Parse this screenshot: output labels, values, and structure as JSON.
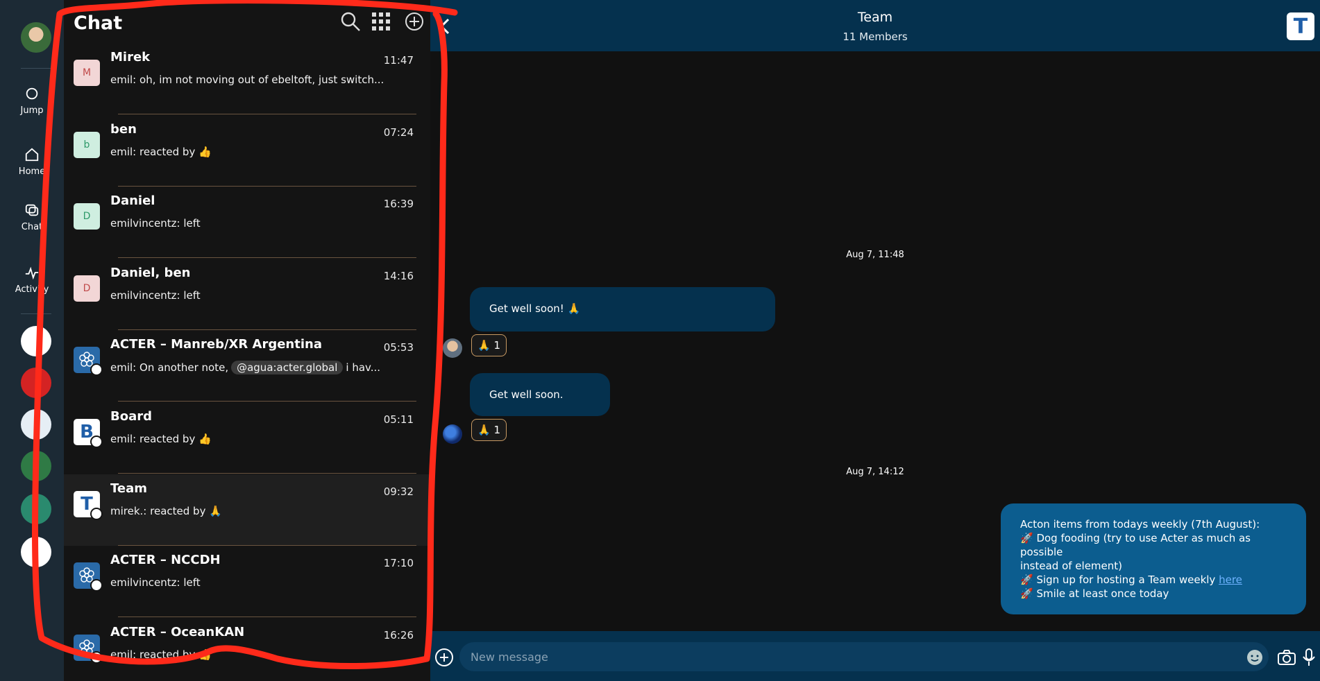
{
  "rail": {
    "items": [
      {
        "label": "Jump"
      },
      {
        "label": "Home"
      },
      {
        "label": "Chat"
      },
      {
        "label": "Activity"
      }
    ],
    "space_colors": [
      "#ffffff",
      "#d42323",
      "#e6eef5",
      "#2f7a45",
      "#2a8a6e",
      "#ffffff"
    ]
  },
  "chatlist": {
    "title": "Chat",
    "rooms": [
      {
        "name": "Mirek",
        "time": "11:47",
        "sender": "emil:",
        "text": "oh, im not moving out of ebeltoft, just switch...",
        "avatar_letter": "M",
        "avatar_bg": "#f2d6d6",
        "avatar_fg": "#c14a4a"
      },
      {
        "name": "ben",
        "time": "07:24",
        "sender": "emil:",
        "text": "reacted by 👍",
        "avatar_letter": "b",
        "avatar_bg": "#cfeee0",
        "avatar_fg": "#2f9a6a"
      },
      {
        "name": "Daniel",
        "time": "16:39",
        "sender": "emilvincentz:",
        "text": "left",
        "avatar_letter": "D",
        "avatar_bg": "#cfeee0",
        "avatar_fg": "#2f9a6a"
      },
      {
        "name": "Daniel, ben",
        "time": "14:16",
        "sender": "emilvincentz:",
        "text": "left",
        "avatar_letter": "D",
        "avatar_bg": "#f2d6d6",
        "avatar_fg": "#c14a4a"
      },
      {
        "name": "ACTER – Manreb/XR Argentina",
        "time": "05:53",
        "sender": "emil:",
        "text_before": "On another note,",
        "mention": "@agua:acter.global",
        "text_after": "i hav...",
        "avatar_letter": "",
        "avatar_bg": "#2a6aa8",
        "avatar_fg": "#ffffff"
      },
      {
        "name": "Board",
        "time": "05:11",
        "sender": "emil:",
        "text": "reacted by 👍",
        "avatar_letter": "B",
        "avatar_bg": "#ffffff",
        "avatar_fg": "#1f5ea8"
      },
      {
        "name": "Team",
        "time": "09:32",
        "sender": "mirek.:",
        "text": "reacted by 🙏",
        "avatar_letter": "T",
        "avatar_bg": "#ffffff",
        "avatar_fg": "#1f5ea8"
      },
      {
        "name": "ACTER – NCCDH",
        "time": "17:10",
        "sender": "emilvincentz:",
        "text": "left",
        "avatar_letter": "",
        "avatar_bg": "#2a6aa8",
        "avatar_fg": "#ffffff"
      },
      {
        "name": "ACTER – OceanKAN",
        "time": "16:26",
        "sender": "emil:",
        "text": "reacted by 👍",
        "avatar_letter": "",
        "avatar_bg": "#2a6aa8",
        "avatar_fg": "#ffffff"
      }
    ]
  },
  "timeline": {
    "title": "Team",
    "subtitle": "11 Members",
    "room_avatar_letter": "T",
    "date_1": "Aug 7, 11:48",
    "date_2": "Aug 7, 14:12",
    "msg_1": "Get well soon! 🙏",
    "msg_1_reaction": "🙏 1",
    "msg_2": "Get well soon.",
    "msg_2_reaction": "🙏 1",
    "own_lines": [
      "Acton items from todays weekly (7th August):",
      "🚀 Dog fooding (try to use Acter as much as possible",
      "instead of element)",
      "🚀 Sign up for hosting a Team weekly",
      "🚀 Smile at least once today"
    ],
    "own_link": "here"
  },
  "composer": {
    "placeholder": "New message"
  },
  "colors": {
    "header": "#05314e",
    "own_bubble": "#0c5d8f",
    "annotation": "#ff2a1a"
  }
}
